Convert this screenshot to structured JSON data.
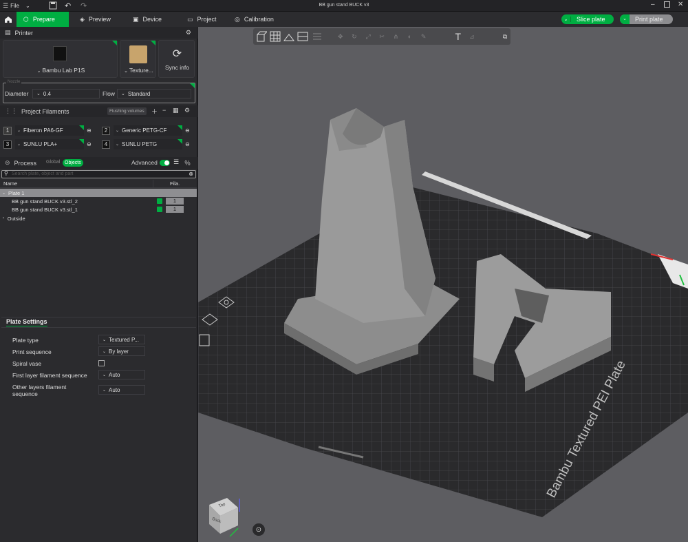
{
  "window": {
    "title": "BB gun stand BUCK v3",
    "file_menu": "File"
  },
  "tabs": [
    {
      "label": "Prepare",
      "active": true
    },
    {
      "label": "Preview"
    },
    {
      "label": "Device"
    },
    {
      "label": "Project"
    },
    {
      "label": "Calibration"
    }
  ],
  "actions": {
    "slice": "Slice plate",
    "print": "Print plate"
  },
  "printer": {
    "section": "Printer",
    "name": "Bambu Lab P1S",
    "plate_label": "Texture...",
    "sync_label": "Sync info",
    "nozzle_group": "Nozzle",
    "diameter_label": "Diameter",
    "diameter_value": "0.4",
    "flow_label": "Flow",
    "flow_value": "Standard"
  },
  "filaments": {
    "section": "Project Filaments",
    "flushing": "Flushing volumes",
    "items": [
      {
        "num": "1",
        "name": "Fiberon PA6-GF",
        "color": "#3a3a3a"
      },
      {
        "num": "2",
        "name": "Generic PETG-CF",
        "color": "#151515"
      },
      {
        "num": "3",
        "name": "SUNLU PLA+",
        "color": "#111111"
      },
      {
        "num": "4",
        "name": "SUNLU PETG",
        "color": "#111111"
      }
    ]
  },
  "process": {
    "section": "Process",
    "global": "Global",
    "objects": "Objects",
    "advanced": "Advanced",
    "search_placeholder": "Search plate, object and part",
    "col_name": "Name",
    "col_fila": "Fila.",
    "plate": "Plate 1",
    "objects_list": [
      {
        "name": "BB gun stand BUCK v3.stl_2",
        "fila": "1"
      },
      {
        "name": "BB gun stand BUCK v3.stl_1",
        "fila": "1"
      }
    ],
    "outside": "Outside"
  },
  "plate_settings": {
    "section": "Plate Settings",
    "rows": [
      {
        "label": "Plate type",
        "value": "Textured P..."
      },
      {
        "label": "Print sequence",
        "value": "By layer"
      },
      {
        "label": "Spiral vase",
        "value": ""
      },
      {
        "label": "First layer filament sequence",
        "value": "Auto"
      },
      {
        "label": "Other layers filament sequence",
        "value": "Auto"
      }
    ]
  },
  "scene": {
    "bed_label": "Bambu Textured PEI Plate",
    "cube_top": "Top",
    "cube_front": "Back"
  },
  "colors": {
    "accent": "#00ae42"
  }
}
